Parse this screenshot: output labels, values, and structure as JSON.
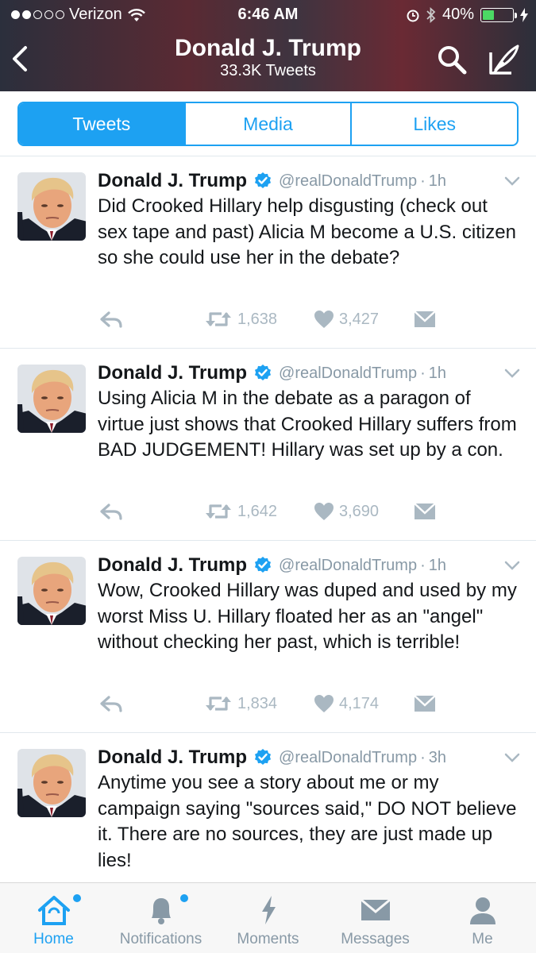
{
  "status_bar": {
    "carrier": "Verizon",
    "signal_dots_filled": 2,
    "signal_dots_total": 5,
    "time": "6:46 AM",
    "battery_percent": "40%",
    "battery_level": 0.4
  },
  "header": {
    "title": "Donald J. Trump",
    "subtitle": "33.3K Tweets"
  },
  "segments": [
    {
      "label": "Tweets",
      "active": true
    },
    {
      "label": "Media",
      "active": false
    },
    {
      "label": "Likes",
      "active": false
    }
  ],
  "tweets": [
    {
      "name": "Donald J. Trump",
      "handle": "@realDonaldTrump",
      "separator": "·",
      "time": "1h",
      "text": "Did Crooked Hillary help disgusting (check out sex tape and past) Alicia M become a U.S. citizen so she could use her in the debate?",
      "retweets": "1,638",
      "likes": "3,427"
    },
    {
      "name": "Donald J. Trump",
      "handle": "@realDonaldTrump",
      "separator": "·",
      "time": "1h",
      "text": "Using Alicia M in the debate as a paragon of virtue just shows that Crooked Hillary suffers from BAD JUDGEMENT! Hillary was set up by a con.",
      "retweets": "1,642",
      "likes": "3,690"
    },
    {
      "name": "Donald J. Trump",
      "handle": "@realDonaldTrump",
      "separator": "·",
      "time": "1h",
      "text": "Wow, Crooked Hillary was duped and used by my worst Miss U. Hillary floated her as an \"angel\" without checking her past, which is terrible!",
      "retweets": "1,834",
      "likes": "4,174"
    },
    {
      "name": "Donald J. Trump",
      "handle": "@realDonaldTrump",
      "separator": "·",
      "time": "3h",
      "text": "Anytime you see a story about me or my campaign saying \"sources said,\" DO NOT believe it. There are no sources, they are just made up lies!",
      "retweets": "",
      "likes": ""
    }
  ],
  "tabbar": [
    {
      "label": "Home",
      "icon": "home-icon",
      "active": true,
      "dot": true
    },
    {
      "label": "Notifications",
      "icon": "bell-icon",
      "active": false,
      "dot": true
    },
    {
      "label": "Moments",
      "icon": "lightning-icon",
      "active": false,
      "dot": false
    },
    {
      "label": "Messages",
      "icon": "envelope-icon",
      "active": false,
      "dot": false
    },
    {
      "label": "Me",
      "icon": "person-icon",
      "active": false,
      "dot": false
    }
  ],
  "colors": {
    "accent": "#1da1f2",
    "action_gray": "#aab8c2",
    "meta_gray": "#8899a6"
  }
}
